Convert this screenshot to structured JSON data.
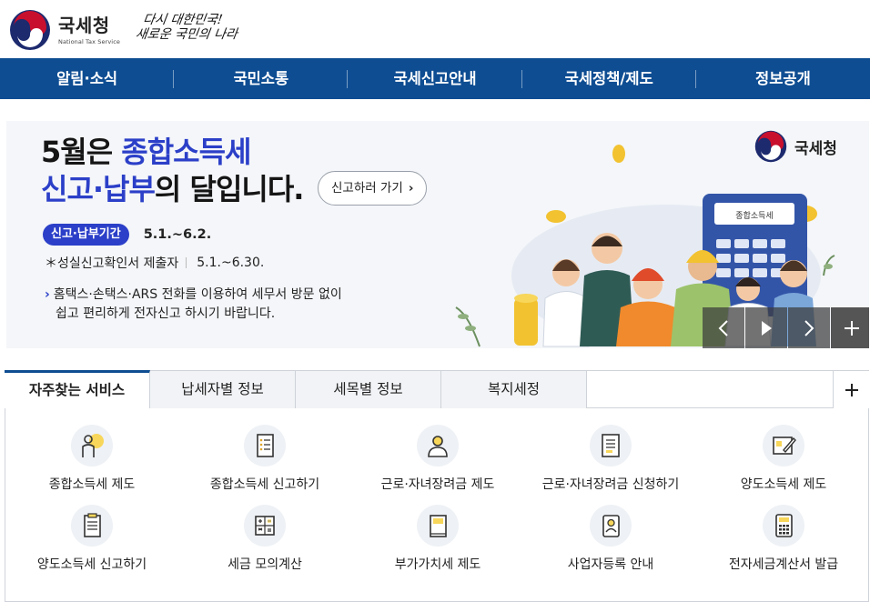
{
  "header": {
    "logo_text": "국세청",
    "logo_sub": "National Tax Service",
    "slogan_line1": "다시 대한민국!",
    "slogan_line2": "새로운 국민의 나라"
  },
  "gnb": [
    "알림·소식",
    "국민소통",
    "국세신고안내",
    "국세정책/제도",
    "정보공개"
  ],
  "banner": {
    "title_line1_plain": "5월은 ",
    "title_line1_highlight": "종합소득세",
    "title_line2_highlight": "신고·납부",
    "title_line2_plain": "의 달입니다.",
    "go_button": "신고하러 가기",
    "period_label": "신고·납부기간",
    "period_date": "5.1.~6.2.",
    "line2_label": "＊성실신고확인서 제출자",
    "line2_date": "5.1.~6.30.",
    "notice_line1": "홈택스·손택스·ARS 전화를 이용하여 세무서 방문 없이",
    "notice_line2": "쉽고 편리하게 전자신고 하시기 바랍니다.",
    "brand": "국세청",
    "calc_label": "종합소득세",
    "colors": {
      "accent": "#2b3fc8",
      "background": "#f4f6f9"
    }
  },
  "tabs": [
    "자주찾는 서비스",
    "납세자별 정보",
    "세목별 정보",
    "복지세정"
  ],
  "services": [
    {
      "label": "종합소득세 제도",
      "icon": "person-lightbulb-icon"
    },
    {
      "label": "종합소득세 신고하기",
      "icon": "document-list-icon"
    },
    {
      "label": "근로·자녀장려금 제도",
      "icon": "person-silhouette-icon"
    },
    {
      "label": "근로·자녀장려금 신청하기",
      "icon": "document-lines-icon"
    },
    {
      "label": "양도소득세 제도",
      "icon": "pen-paper-icon"
    },
    {
      "label": "양도소득세 신고하기",
      "icon": "clipboard-icon"
    },
    {
      "label": "세금 모의계산",
      "icon": "calculator-signs-icon"
    },
    {
      "label": "부가가치세 제도",
      "icon": "book-icon"
    },
    {
      "label": "사업자등록 안내",
      "icon": "id-badge-icon"
    },
    {
      "label": "전자세금계산서 발급",
      "icon": "calculator-icon"
    }
  ],
  "colors": {
    "gnb": "#0e4d92",
    "tab_border": "#cfd3d9"
  }
}
